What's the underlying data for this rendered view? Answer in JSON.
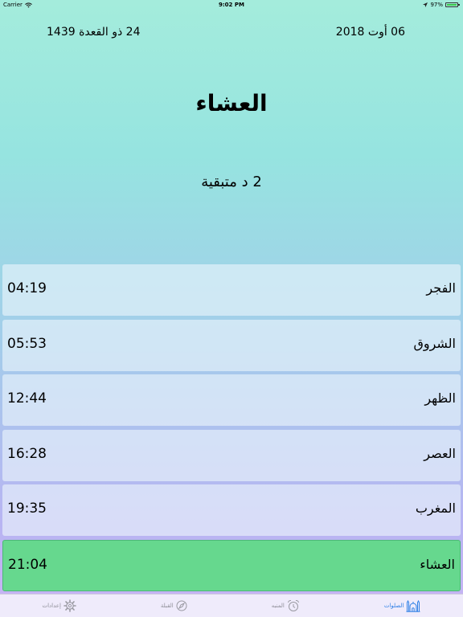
{
  "status_bar": {
    "carrier": "Carrier",
    "time": "9:02 PM",
    "battery": "97%",
    "battery_level": 0.97
  },
  "dates": {
    "hijri": "24 ذو القعدة 1439",
    "gregorian": "06 أوت 2018"
  },
  "next_prayer": {
    "name": "العشاء",
    "remaining": "2 د متبقية"
  },
  "prayers": [
    {
      "name": "الفجر",
      "time": "04:19"
    },
    {
      "name": "الشروق",
      "time": "05:53"
    },
    {
      "name": "الظهر",
      "time": "12:44"
    },
    {
      "name": "العصر",
      "time": "16:28"
    },
    {
      "name": "المغرب",
      "time": "19:35"
    },
    {
      "name": "العشاء",
      "time": "21:04"
    }
  ],
  "tabs": [
    {
      "label": "إعدادات",
      "icon": "gear-icon"
    },
    {
      "label": "القبلة",
      "icon": "compass-icon"
    },
    {
      "label": "المنبه",
      "icon": "alarm-clock-icon"
    },
    {
      "label": "الصلوات",
      "icon": "mosque-icon"
    }
  ],
  "colors": {
    "active_row": "#66d88e",
    "tab_selected": "#2d7fe6",
    "tab_default": "#8f8f98"
  }
}
